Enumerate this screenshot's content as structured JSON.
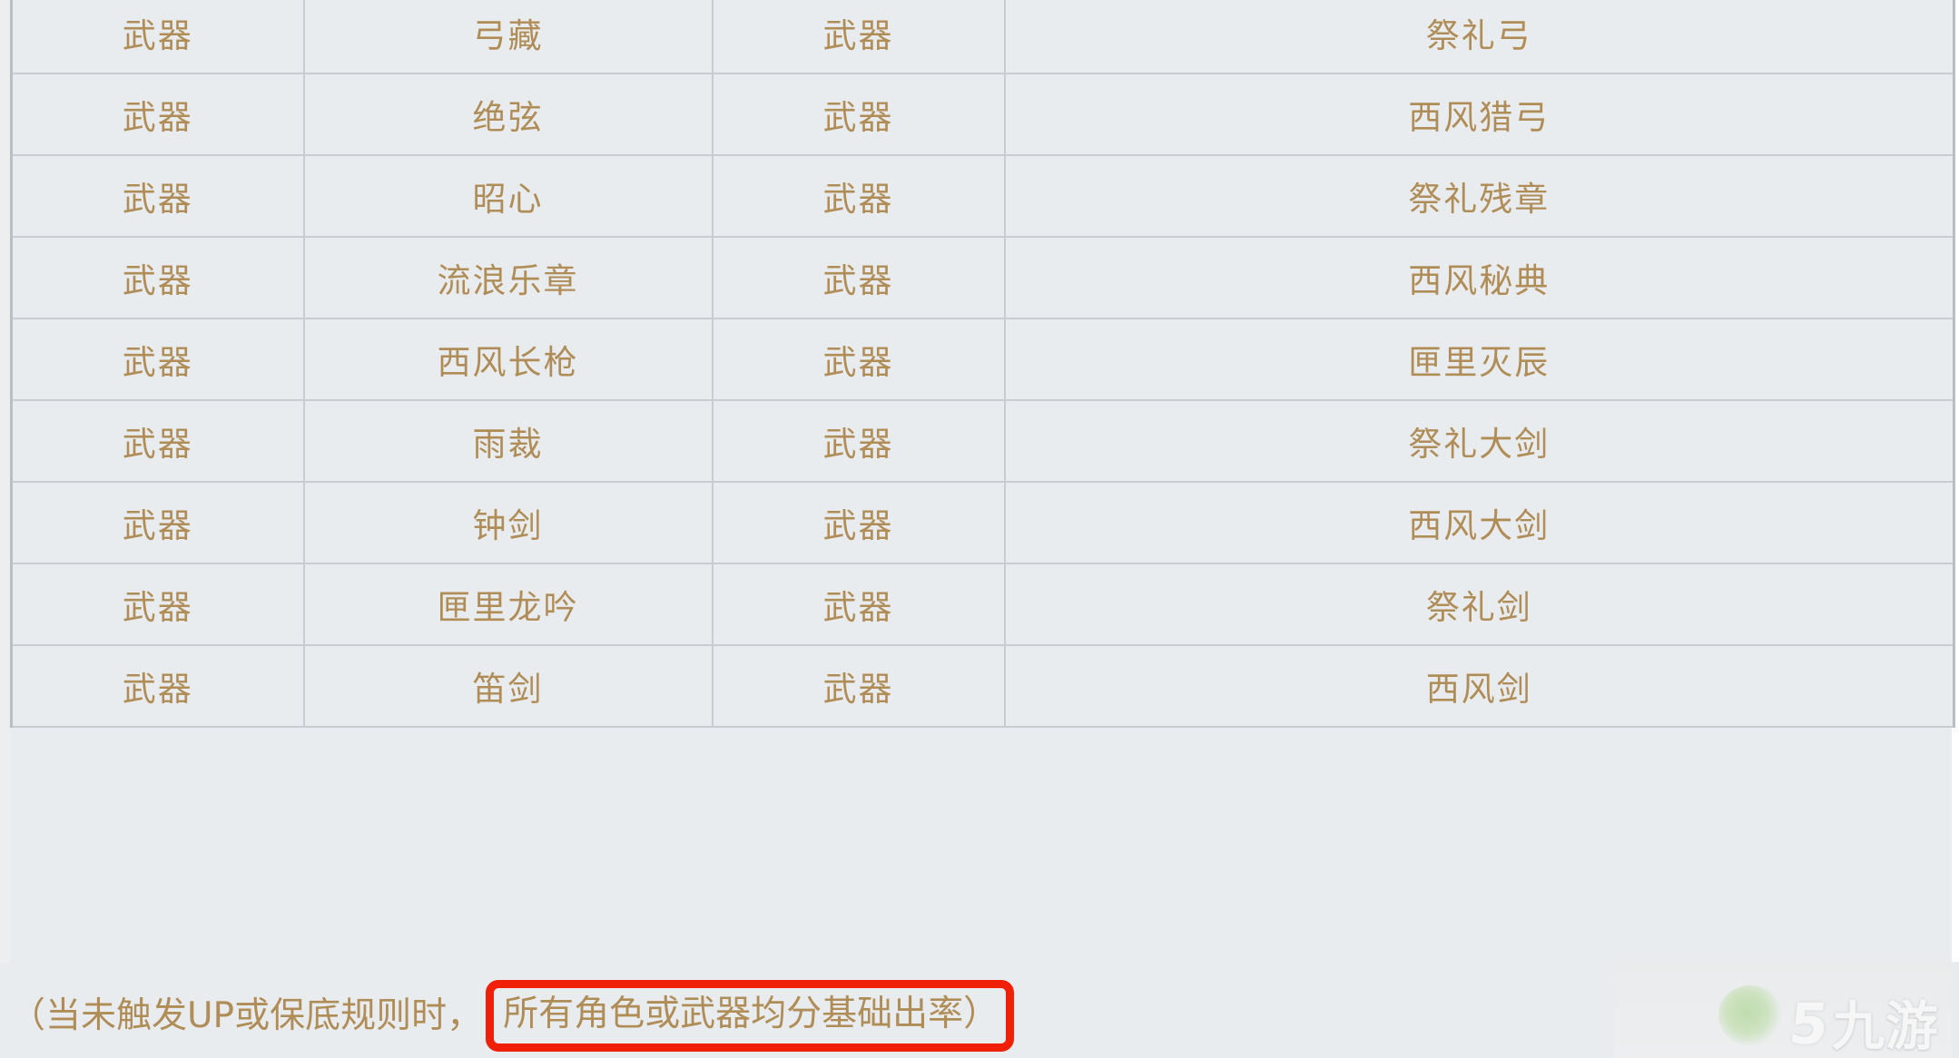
{
  "table": {
    "columns": [
      "pool_type_left",
      "item_name_left",
      "pool_type_right",
      "item_name_right"
    ],
    "rows": [
      {
        "c1": "武器",
        "c2": "弓藏",
        "c3": "武器",
        "c4": "祭礼弓"
      },
      {
        "c1": "武器",
        "c2": "绝弦",
        "c3": "武器",
        "c4": "西风猎弓"
      },
      {
        "c1": "武器",
        "c2": "昭心",
        "c3": "武器",
        "c4": "祭礼残章"
      },
      {
        "c1": "武器",
        "c2": "流浪乐章",
        "c3": "武器",
        "c4": "西风秘典"
      },
      {
        "c1": "武器",
        "c2": "西风长枪",
        "c3": "武器",
        "c4": "匣里灭辰"
      },
      {
        "c1": "武器",
        "c2": "雨裁",
        "c3": "武器",
        "c4": "祭礼大剑"
      },
      {
        "c1": "武器",
        "c2": "钟剑",
        "c3": "武器",
        "c4": "西风大剑"
      },
      {
        "c1": "武器",
        "c2": "匣里龙吟",
        "c3": "武器",
        "c4": "祭礼剑"
      },
      {
        "c1": "武器",
        "c2": "笛剑",
        "c3": "武器",
        "c4": "西风剑"
      }
    ]
  },
  "footnote": {
    "prefix": "（当未触发UP或保底规则时，",
    "highlighted": "所有角色或武器均分基础出率）",
    "highlight_color": "#f01f08"
  },
  "watermark": {
    "logo_mark": "5",
    "label": "九游"
  },
  "colors": {
    "text": "#b08d57",
    "cell_background": "#e9ecef",
    "border": "#c9cdd1",
    "highlight": "#f01f08"
  }
}
